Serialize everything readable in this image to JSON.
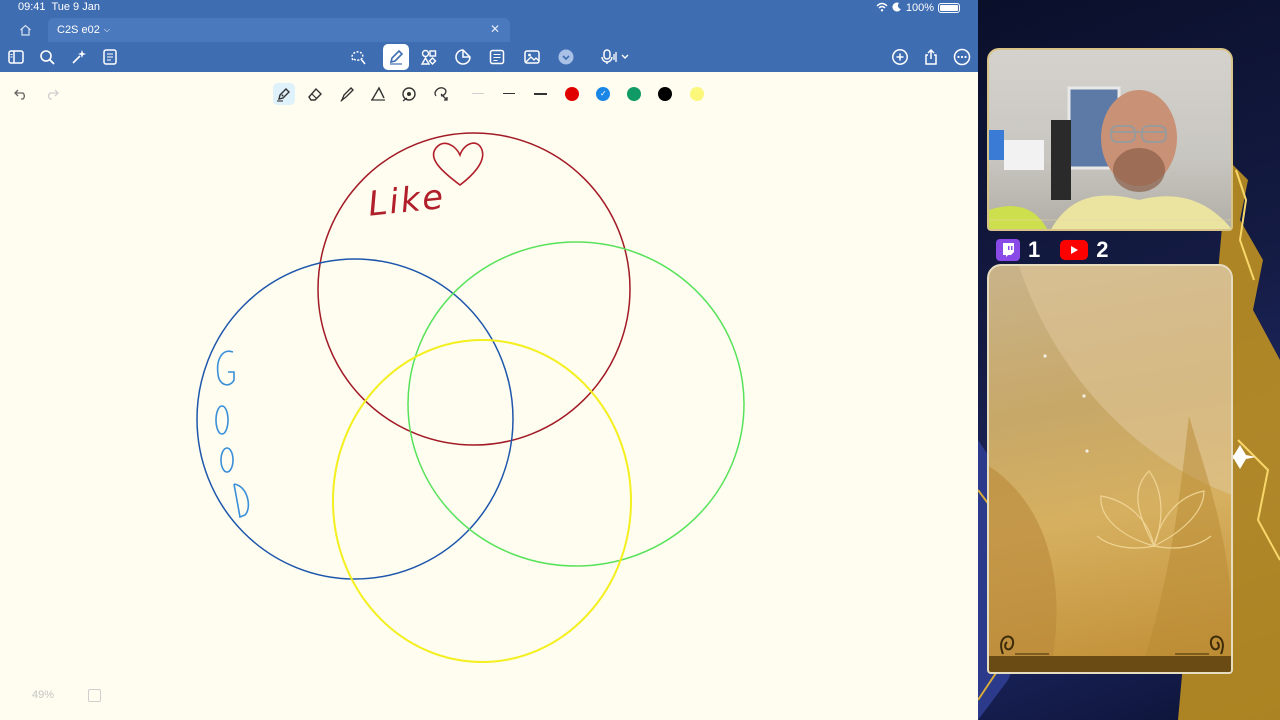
{
  "status_bar": {
    "time": "09:41",
    "date": "Tue 9 Jan",
    "battery": "100%"
  },
  "tab": {
    "title": "C2S e02"
  },
  "canvas": {
    "zoom": "49%",
    "label_like": "Like",
    "label_good": "GOOD"
  },
  "pen_palette": {
    "colors": [
      "#e00000",
      "#1a86e6",
      "#109a65",
      "#000000",
      "#fbf77b"
    ],
    "selected_color": "#1a86e6"
  },
  "stream": {
    "twitch_count": "1",
    "youtube_count": "2"
  },
  "icons": {
    "home": "home-icon",
    "sidebar": "sidebar-icon",
    "search": "search-icon",
    "sparkle": "ai-sparkle-icon",
    "notes": "notes-icon",
    "lasso": "lasso-icon",
    "pen": "pen-icon",
    "shapes": "shapes-icon",
    "stickers": "stickers-icon",
    "text": "textbox-icon",
    "image": "image-icon",
    "mic": "microphone-icon",
    "add": "add-icon",
    "share": "share-icon",
    "more": "more-icon"
  }
}
